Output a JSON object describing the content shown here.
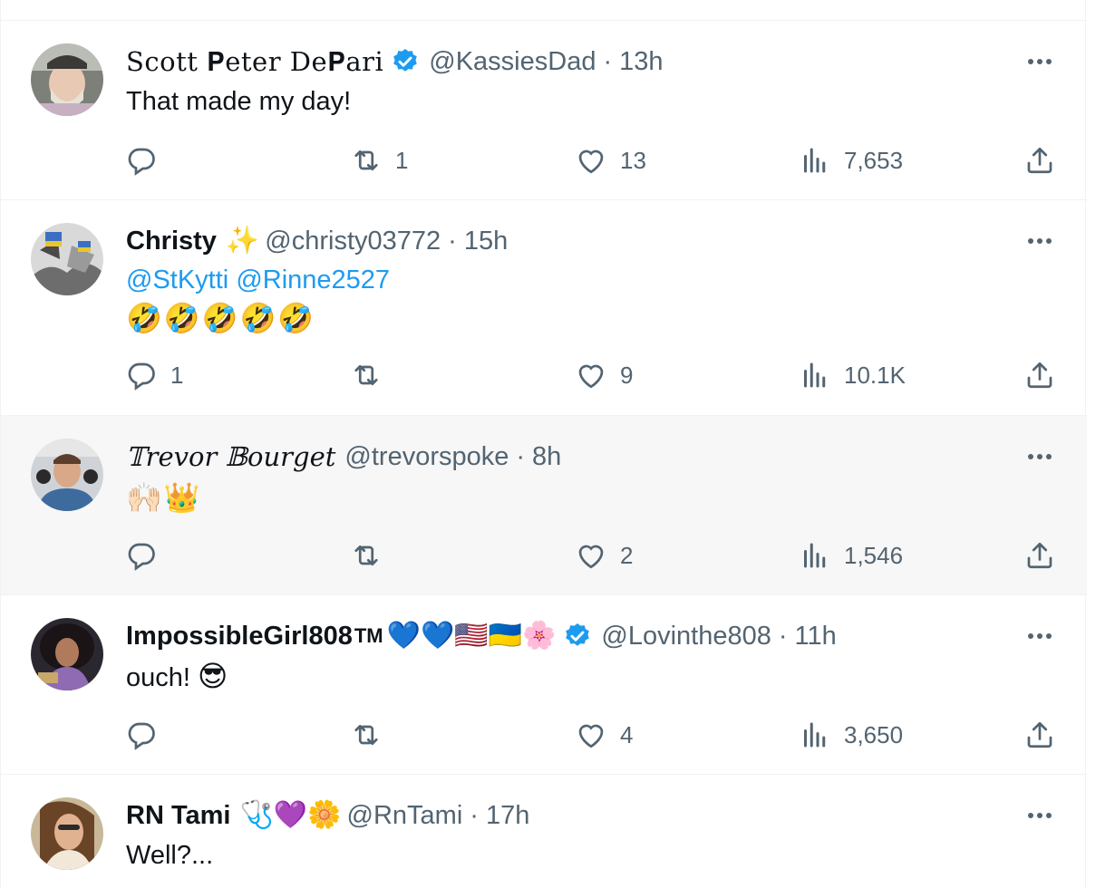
{
  "tweets": [
    {
      "name": "Scott 𝐏eter De𝐏ari",
      "verified": true,
      "handle": "@KassiesDad",
      "time": "13h",
      "text": "That made my day!",
      "replies": "",
      "retweets": "1",
      "likes": "13",
      "views": "7,653"
    },
    {
      "name": "Christy",
      "name_emoji": "✨",
      "handle": "@christy03772",
      "time": "15h",
      "mentions": [
        "@StKytti",
        "@Rinne2527"
      ],
      "emoji_text": "🤣🤣🤣🤣🤣",
      "replies": "1",
      "retweets": "",
      "likes": "9",
      "views": "10.1K"
    },
    {
      "name": "𝕋revor 𝔹ourget",
      "handle": "@trevorspoke",
      "time": "8h",
      "emoji_text": "🙌🏻👑",
      "replies": "",
      "retweets": "",
      "likes": "2",
      "views": "1,546"
    },
    {
      "name": "ImpossibleGirl808",
      "name_suffix": "TM",
      "name_emojis": "💙💙🇺🇸🇺🇦🌸",
      "verified": true,
      "handle": "@Lovinthe808",
      "time": "11h",
      "text": "ouch!",
      "text_emoji": "😎",
      "replies": "",
      "retweets": "",
      "likes": "4",
      "views": "3,650"
    },
    {
      "name": "RN Tami",
      "name_emojis": "🩺💜🌼",
      "handle": "@RnTami",
      "time": "17h",
      "text": "Well?..."
    }
  ],
  "separator": "·",
  "colors": {
    "accent": "#1d9bf0",
    "secondary_text": "#536471",
    "border": "#eff3f4",
    "hover_bg": "#f7f7f7"
  },
  "icons": {
    "reply": "reply-icon",
    "retweet": "retweet-icon",
    "like": "heart-icon",
    "views": "views-icon",
    "share": "share-icon",
    "more": "more-icon",
    "verified": "verified-badge-icon"
  }
}
